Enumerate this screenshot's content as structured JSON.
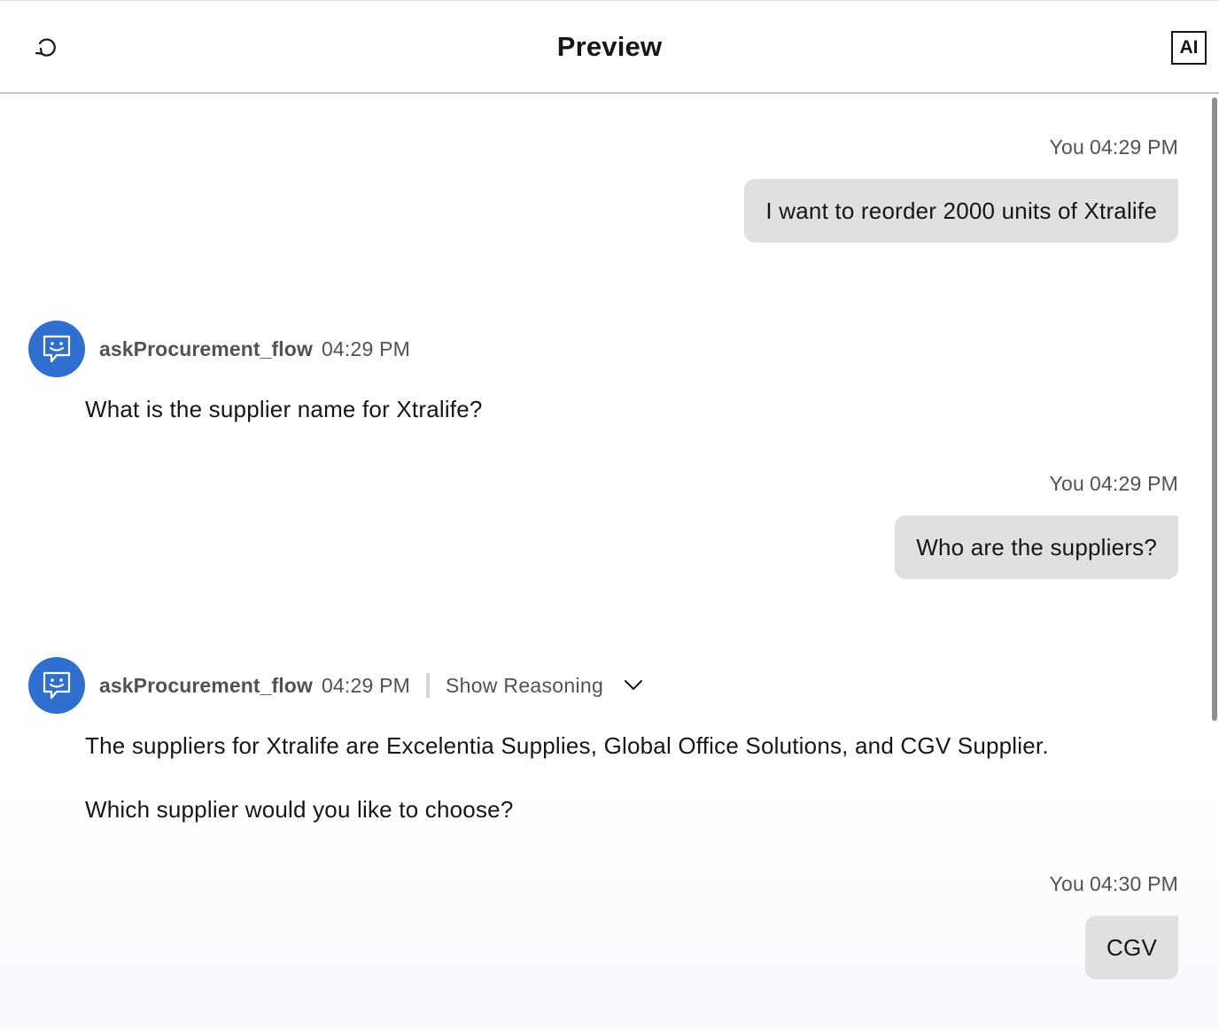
{
  "header": {
    "title": "Preview",
    "reset_icon": "reset-icon",
    "ai_badge": "AI"
  },
  "messages": {
    "m1": {
      "sender": "You",
      "time": "04:29 PM",
      "text": "I want to reorder 2000 units of Xtralife"
    },
    "m2": {
      "sender": "askProcurement_flow",
      "time": "04:29 PM",
      "text": "What is the supplier name for Xtralife?",
      "avatar_icon": "chat-bot-icon"
    },
    "m3": {
      "sender": "You",
      "time": "04:29 PM",
      "text": "Who are the suppliers?"
    },
    "m4": {
      "sender": "askProcurement_flow",
      "time": "04:29 PM",
      "reasoning_label": "Show Reasoning",
      "text_line1": "The suppliers for Xtralife are Excelentia Supplies, Global Office Solutions, and CGV Supplier.",
      "text_line2": "Which supplier would you like to choose?",
      "avatar_icon": "chat-bot-icon"
    },
    "m5": {
      "sender": "You",
      "time": "04:30 PM",
      "text": "CGV"
    }
  },
  "colors": {
    "avatar_bg": "#2f6fcf",
    "user_bubble": "#e0e0e0",
    "text_primary": "#161616",
    "text_secondary": "#525252"
  }
}
